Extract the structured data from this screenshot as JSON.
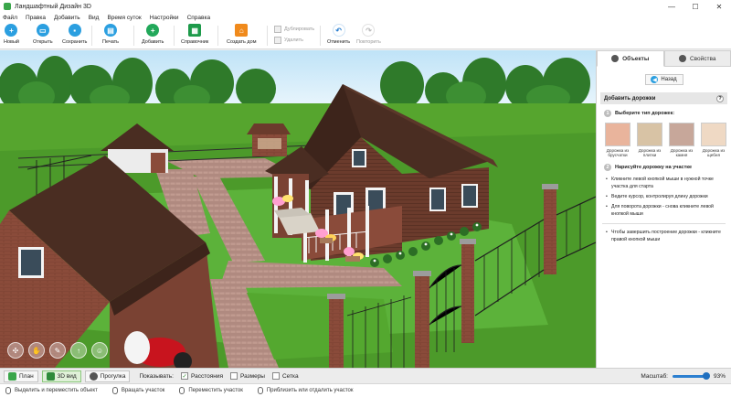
{
  "window": {
    "title": "Ландшафтный Дизайн 3D",
    "controls": [
      "—",
      "☐",
      "✕"
    ]
  },
  "menu": [
    "Файл",
    "Правка",
    "Добавить",
    "Вид",
    "Время суток",
    "Настройки",
    "Справка"
  ],
  "toolbar": {
    "new": "Новый",
    "open": "Открыть",
    "save": "Сохранить",
    "print": "Печать",
    "add": "Добавить",
    "reference": "Справочник",
    "build_house": "Создать дом",
    "duplicate": "Дублировать",
    "delete": "Удалить",
    "undo": "Отменить",
    "redo": "Повторить"
  },
  "panel": {
    "tabs": [
      "Объекты",
      "Свойства"
    ],
    "back": "Назад",
    "section_title": "Добавить дорожки",
    "step1": {
      "num": "1",
      "label": "Выберите тип дорожек:"
    },
    "paths": [
      {
        "label": "Дорожка из брусчатки",
        "color": "#e9b49c"
      },
      {
        "label": "Дорожка из плитки",
        "color": "#d8c3a5"
      },
      {
        "label": "Дорожка из камня",
        "color": "#c7a79a"
      },
      {
        "label": "Дорожка из щебня",
        "color": "#efd9c4"
      }
    ],
    "step2": {
      "num": "2",
      "label": "Нарисуйте дорожку на участке"
    },
    "instructions": [
      "Кликните левой кнопкой мыши в нужной точке участка для старта",
      "Ведите курсор, контролируя длину дорожки",
      "Для поворота дорожки - снова кликните левой кнопкой мыши"
    ],
    "finish": "Чтобы завершить построение дорожки - кликните правой кнопкой мыши"
  },
  "viewbar": {
    "plan": "План",
    "view3d": "3D вид",
    "walk": "Прогулка",
    "show_label": "Показывать:",
    "distances": "Расстояния",
    "sizes": "Размеры",
    "grid": "Сетка",
    "scale_label": "Масштаб:",
    "scale_value": "93%",
    "scale_fraction": 0.93
  },
  "status": [
    "Выделить и переместить объект",
    "Вращать участок",
    "Переместить участок",
    "Приблизить или отдалить участок"
  ],
  "colors": {
    "accent": "#2b9fe0",
    "grass": "#4c9a2a",
    "roof": "#4a2d22",
    "brick": "#8a4b3a"
  }
}
